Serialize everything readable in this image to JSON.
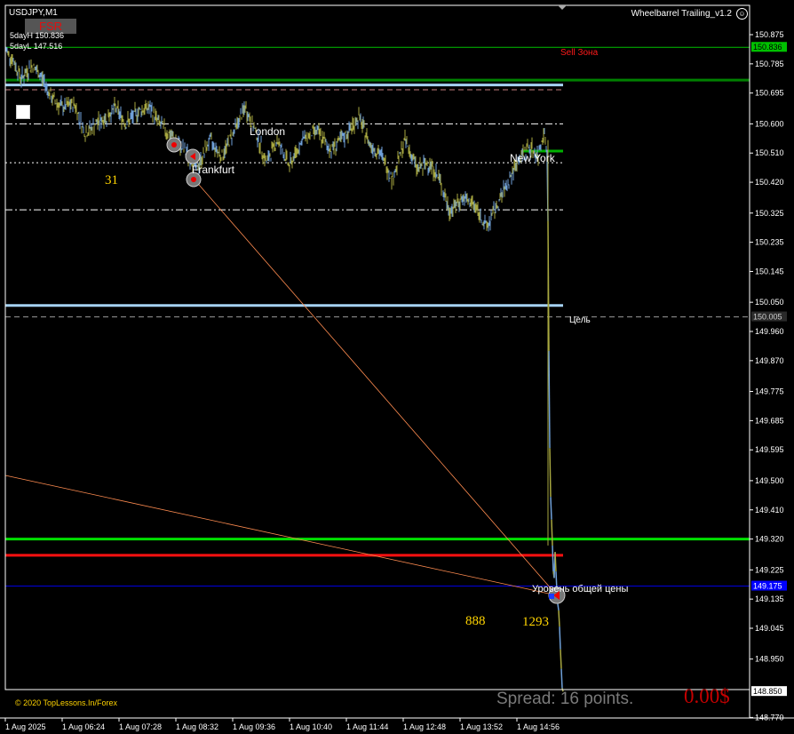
{
  "window": {
    "symbol_title": "USDJPY,M1",
    "expert_name": "Wheelbarrel Trailing_v1.2",
    "expert_icon": "smiley-icon"
  },
  "overlay": {
    "badge": "FSR",
    "five_day_high": "5dayH 150.836",
    "five_day_low": "5dayL 147.516",
    "sell_zone": "Sell Зона",
    "target_label": "Цель",
    "avg_price_label": "Уровень общей цены",
    "counter_left": "31",
    "counter_mid": "888",
    "counter_right": "1293",
    "copyright": "© 2020 TopLessons.In/Forex",
    "spread": "Spread: 16 points.",
    "profit": "0.00$"
  },
  "sessions": {
    "london": "London",
    "frankfurt": "Frankfurt",
    "new_york": "New York"
  },
  "price_axis": {
    "ticks": [
      "150.875",
      "150.785",
      "150.695",
      "150.600",
      "150.510",
      "150.420",
      "150.325",
      "150.235",
      "150.145",
      "150.050",
      "149.960",
      "149.870",
      "149.775",
      "149.685",
      "149.595",
      "149.500",
      "149.410",
      "149.320",
      "149.225",
      "149.135",
      "149.045",
      "148.950",
      "148.770"
    ],
    "boxes": [
      {
        "label": "150.836",
        "price": 150.836,
        "bg": "#00c000",
        "fg": "#000000"
      },
      {
        "label": "150.005",
        "price": 150.005,
        "bg": "#2a2a2a",
        "fg": "#cfcfcf"
      },
      {
        "label": "149.175",
        "price": 149.175,
        "bg": "#0000ff",
        "fg": "#ffffff"
      },
      {
        "label": "148.850",
        "price": 148.85,
        "bg": "#ffffff",
        "fg": "#000000"
      }
    ]
  },
  "time_axis": {
    "labels": [
      "1 Aug 2025",
      "1 Aug 06:24",
      "1 Aug 07:28",
      "1 Aug 08:32",
      "1 Aug 09:36",
      "1 Aug 10:40",
      "1 Aug 11:44",
      "1 Aug 12:48",
      "1 Aug 13:52",
      "1 Aug 14:56"
    ]
  },
  "levels": [
    {
      "name": "five-day-high-line",
      "price": 150.836,
      "color": "#00c000",
      "style": "solid",
      "width": 1
    },
    {
      "name": "sell-zone-green-line",
      "price": 150.735,
      "color": "#008000",
      "style": "solid",
      "width": 3
    },
    {
      "name": "light-blue-upper-line",
      "price": 150.72,
      "color": "#a6d2f2",
      "style": "solid",
      "width": 3
    },
    {
      "name": "pink-dashed-line",
      "price": 150.705,
      "color": "#c88080",
      "style": "dash",
      "width": 1
    },
    {
      "name": "upper-dashdot-line",
      "price": 150.6,
      "color": "#ffffff",
      "style": "dashdot",
      "width": 1
    },
    {
      "name": "white-dotted-line",
      "price": 150.48,
      "color": "#ffffff",
      "style": "dot",
      "width": 1
    },
    {
      "name": "lower-dashdot-line",
      "price": 150.335,
      "color": "#ffffff",
      "style": "dashdot",
      "width": 1
    },
    {
      "name": "light-blue-lower-line",
      "price": 150.04,
      "color": "#a6d2f2",
      "style": "solid",
      "width": 3
    },
    {
      "name": "target-dashed-line",
      "price": 150.005,
      "color": "#9a9a9a",
      "style": "dash",
      "width": 1
    },
    {
      "name": "green-level-line",
      "price": 149.32,
      "color": "#00e000",
      "style": "solid",
      "width": 3
    },
    {
      "name": "red-level-line",
      "price": 149.27,
      "color": "#ff1010",
      "style": "solid",
      "width": 3
    },
    {
      "name": "blue-avg-price-line",
      "price": 149.175,
      "color": "#0000e0",
      "style": "solid",
      "width": 1
    }
  ],
  "colors": {
    "background": "#000000",
    "candle": "#a8a840",
    "candle_alt": "#6fa0d8",
    "trend_line": "#ff8c50"
  }
}
